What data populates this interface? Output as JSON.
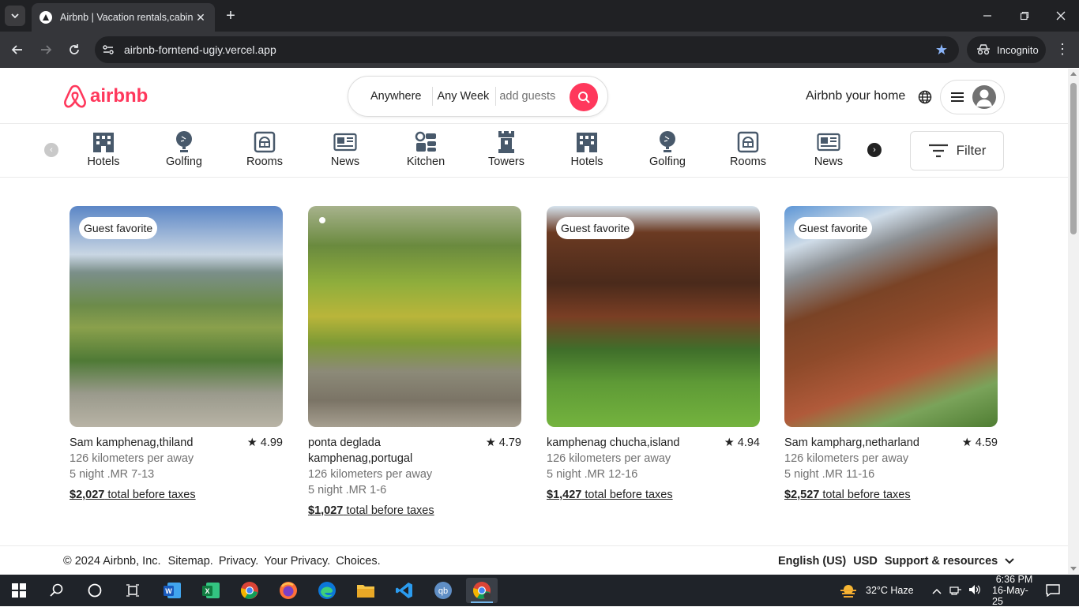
{
  "browser": {
    "tab_title": "Airbnb | Vacation rentals,cabin",
    "url": "airbnb-forntend-ugiy.vercel.app",
    "incognito_label": "Incognito"
  },
  "header": {
    "logo_text": "airbnb",
    "search": {
      "location": "Anywhere",
      "dates": "Any Week",
      "guests_placeholder": "add guests"
    },
    "host_link": "Airbnb your home"
  },
  "categories": [
    {
      "label": "Hotels",
      "icon": "hotel-icon"
    },
    {
      "label": "Golfing",
      "icon": "golf-icon"
    },
    {
      "label": "Rooms",
      "icon": "rooms-icon"
    },
    {
      "label": "News",
      "icon": "news-icon"
    },
    {
      "label": "Kitchen",
      "icon": "kitchen-icon"
    },
    {
      "label": "Towers",
      "icon": "tower-icon"
    },
    {
      "label": "Hotels",
      "icon": "hotel-icon"
    },
    {
      "label": "Golfing",
      "icon": "golf-icon"
    },
    {
      "label": "Rooms",
      "icon": "rooms-icon"
    },
    {
      "label": "News",
      "icon": "news-icon"
    }
  ],
  "filter_label": "Filter",
  "listings": [
    {
      "badge": "Guest favorite",
      "title": "Sam kamphenag,thiland",
      "rating": "4.99",
      "distance": "126 kilometers per away",
      "dates": "5 night .MR 7-13",
      "price": "$2,027",
      "price_suffix": " total before taxes"
    },
    {
      "badge": "",
      "title": "ponta deglada kamphenag,portugal",
      "rating": "4.79",
      "distance": "126 kilometers per away",
      "dates": "5 night .MR 1-6",
      "price": "$1,027",
      "price_suffix": " total before taxes"
    },
    {
      "badge": "Guest favorite",
      "title": "kamphenag chucha,island",
      "rating": "4.94",
      "distance": "126 kilometers per away",
      "dates": "5 night .MR 12-16",
      "price": "$1,427",
      "price_suffix": " total before taxes"
    },
    {
      "badge": "Guest favorite",
      "title": "Sam kampharg,netharland",
      "rating": "4.59",
      "distance": "126 kilometers per away",
      "dates": "5 night .MR 11-16",
      "price": "$2,527",
      "price_suffix": " total before taxes"
    }
  ],
  "footer": {
    "copyright": "© 2024 Airbnb, Inc.",
    "links": [
      "Sitemap.",
      "Privacy.",
      "Your Privacy.",
      "Choices."
    ],
    "language": "English (US)",
    "currency": "USD",
    "support": "Support & resources"
  },
  "taskbar": {
    "weather": "32°C  Haze",
    "time": "6:36 PM",
    "date": "16-May-25"
  },
  "colors": {
    "brand": "#ff385c",
    "browser_dark": "#202124",
    "taskbar": "#1f2329"
  }
}
